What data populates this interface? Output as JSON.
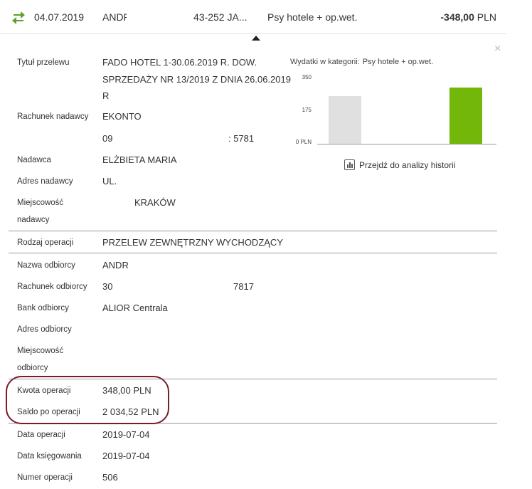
{
  "transaction": {
    "icon": "transfer-arrows-icon",
    "date": "04.07.2019",
    "name": "ANDF",
    "account": "43-252 JA...",
    "category": "Psy hotele + op.wet.",
    "amount": "-348,00",
    "currency": "PLN"
  },
  "close_label": "×",
  "details": {
    "title_label": "Tytuł przelewu",
    "title_lines": [
      "FADO HOTEL 1-30.06.2019 R. DOW.",
      "SPRZEDAŻY NR 13/2019 Z DNIA 26.06.2019",
      "R"
    ],
    "sender_account_label": "Rachunek nadawcy",
    "sender_account_name": "EKONTO",
    "sender_account_prefix": "09",
    "sender_account_suffix": ": 5781",
    "sender_label": "Nadawca",
    "sender_value": "ELŻBIETA MARIA",
    "sender_address_label": "Adres nadawcy",
    "sender_address_value": "UL.",
    "sender_city_label_1": "Miejscowość",
    "sender_city_label_2": "nadawcy",
    "sender_city_value": "KRAKÓW",
    "operation_type_label": "Rodzaj operacji",
    "operation_type_value": "PRZELEW ZEWNĘTRZNY WYCHODZĄCY",
    "recipient_name_label": "Nazwa odbiorcy",
    "recipient_name_value": "ANDR",
    "recipient_account_label": "Rachunek odbiorcy",
    "recipient_account_prefix": "30",
    "recipient_account_suffix": "7817",
    "recipient_bank_label": "Bank odbiorcy",
    "recipient_bank_value": "ALIOR Centrala",
    "recipient_address_label": "Adres odbiorcy",
    "recipient_city_label_1": "Miejscowość",
    "recipient_city_label_2": "odbiorcy",
    "amount_label": "Kwota operacji",
    "amount_value": "348,00 PLN",
    "balance_label": "Saldo po operacji",
    "balance_value": "2 034,52 PLN",
    "operation_date_label": "Data operacji",
    "operation_date_value": "2019-07-04",
    "booking_date_label": "Data księgowania",
    "booking_date_value": "2019-07-04",
    "operation_number_label": "Numer operacji",
    "operation_number_value": "506"
  },
  "chart_title": "Wydatki w kategorii:",
  "chart_category": "Psy hotele + op.wet.",
  "analysis_link": "Przejdź do analizy historii",
  "chart_data": {
    "type": "bar",
    "title": "Wydatki w kategorii: Psy hotele + op.wet.",
    "ylim": [
      0,
      350
    ],
    "yticks": [
      "350",
      "175",
      "0 PLN"
    ],
    "values": [
      255,
      300
    ],
    "colors": [
      "#e0e0e0",
      "#73b70a"
    ],
    "grid": false
  }
}
